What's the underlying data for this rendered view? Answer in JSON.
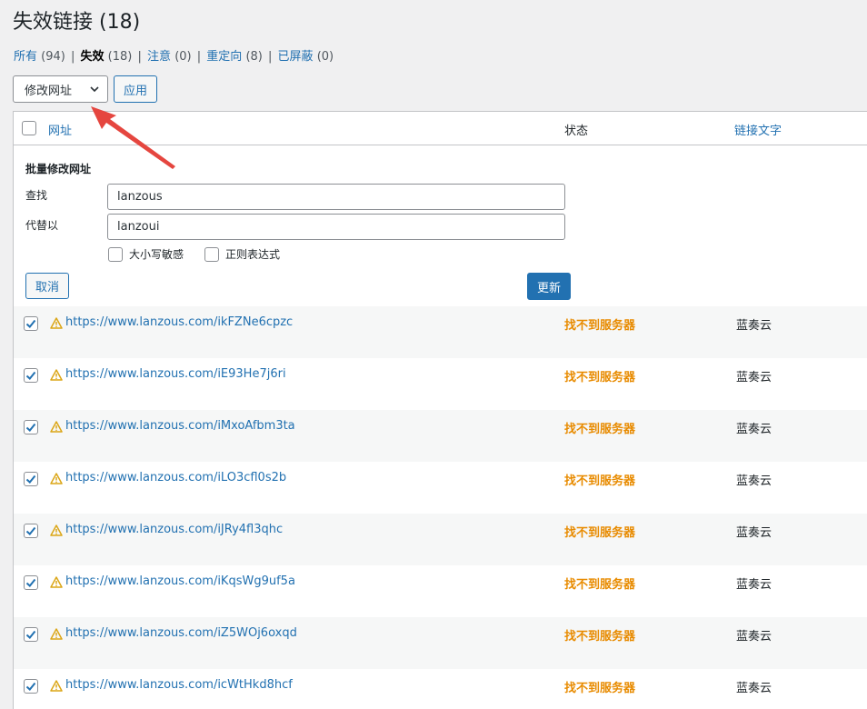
{
  "page_title": "失效链接 (18)",
  "filters": [
    {
      "label": "所有",
      "count": "(94)",
      "current": false
    },
    {
      "label": "失效",
      "count": "(18)",
      "current": true
    },
    {
      "label": "注意",
      "count": "(0)",
      "current": false
    },
    {
      "label": "重定向",
      "count": "(8)",
      "current": false
    },
    {
      "label": "已屏蔽",
      "count": "(0)",
      "current": false
    }
  ],
  "bulk_action": {
    "selected": "修改网址",
    "apply_label": "应用"
  },
  "table": {
    "headers": {
      "url": "网址",
      "status": "状态",
      "link_text": "链接文字"
    }
  },
  "bulk_edit": {
    "title": "批量修改网址",
    "find_label": "查找",
    "find_value": "lanzous",
    "replace_label": "代替以",
    "replace_value": "lanzoui",
    "case_label": "大小写敏感",
    "regex_label": "正则表达式",
    "cancel_label": "取消",
    "update_label": "更新"
  },
  "colors": {
    "accent": "#2271b1",
    "status_error": "#e88b00",
    "warning_icon": "#dba617",
    "arrow": "#e5463f"
  },
  "rows": [
    {
      "url": "https://www.lanzous.com/ikFZNe6cpzc",
      "status": "找不到服务器",
      "link_text": "蓝奏云",
      "checked": true
    },
    {
      "url": "https://www.lanzous.com/iE93He7j6ri",
      "status": "找不到服务器",
      "link_text": "蓝奏云",
      "checked": true
    },
    {
      "url": "https://www.lanzous.com/iMxoAfbm3ta",
      "status": "找不到服务器",
      "link_text": "蓝奏云",
      "checked": true
    },
    {
      "url": "https://www.lanzous.com/iLO3cfl0s2b",
      "status": "找不到服务器",
      "link_text": "蓝奏云",
      "checked": true
    },
    {
      "url": "https://www.lanzous.com/iJRy4fl3qhc",
      "status": "找不到服务器",
      "link_text": "蓝奏云",
      "checked": true
    },
    {
      "url": "https://www.lanzous.com/iKqsWg9uf5a",
      "status": "找不到服务器",
      "link_text": "蓝奏云",
      "checked": true
    },
    {
      "url": "https://www.lanzous.com/iZ5WOj6oxqd",
      "status": "找不到服务器",
      "link_text": "蓝奏云",
      "checked": true
    },
    {
      "url": "https://www.lanzous.com/icWtHkd8hcf",
      "status": "找不到服务器",
      "link_text": "蓝奏云",
      "checked": true
    }
  ]
}
